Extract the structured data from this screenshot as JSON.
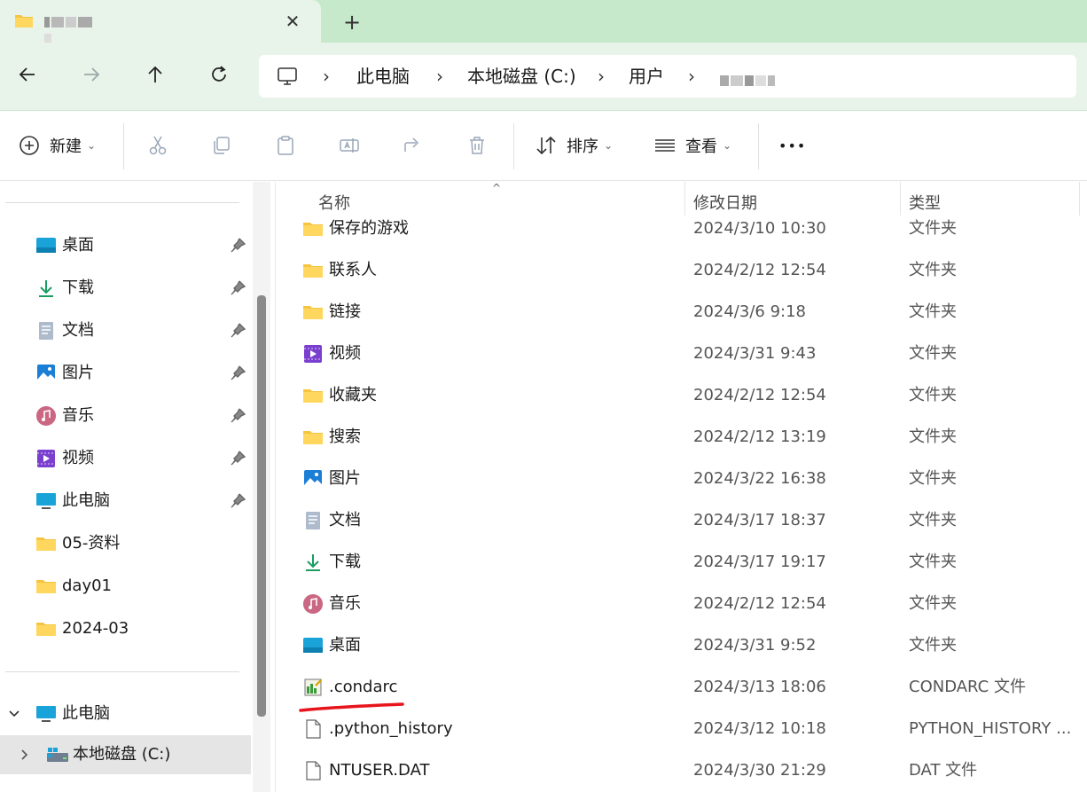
{
  "tab": {
    "close_glyph": "✕",
    "new_tab_glyph": "+"
  },
  "breadcrumb": {
    "items": [
      "此电脑",
      "本地磁盘 (C:)",
      "用户"
    ],
    "separator": "›"
  },
  "toolbar": {
    "new_label": "新建",
    "sort_label": "排序",
    "view_label": "查看",
    "more_label": "•••"
  },
  "sidebar": {
    "quick_access": [
      {
        "label": "桌面",
        "icon": "desktop-icon",
        "pinned": true
      },
      {
        "label": "下载",
        "icon": "download-icon",
        "pinned": true
      },
      {
        "label": "文档",
        "icon": "document-icon",
        "pinned": true
      },
      {
        "label": "图片",
        "icon": "pictures-icon",
        "pinned": true
      },
      {
        "label": "音乐",
        "icon": "music-icon",
        "pinned": true
      },
      {
        "label": "视频",
        "icon": "video-icon",
        "pinned": true
      },
      {
        "label": "此电脑",
        "icon": "computer-icon",
        "pinned": true
      },
      {
        "label": "05-资料",
        "icon": "folder-icon",
        "pinned": false
      },
      {
        "label": "day01",
        "icon": "folder-icon",
        "pinned": false
      },
      {
        "label": "2024-03",
        "icon": "folder-icon",
        "pinned": false
      }
    ],
    "this_pc_label": "此电脑",
    "local_disk_label": "本地磁盘 (C:)"
  },
  "columns": {
    "name": "名称",
    "modified": "修改日期",
    "type": "类型"
  },
  "files": [
    {
      "name": "保存的游戏",
      "modified": "2024/3/10 10:30",
      "type": "文件夹",
      "icon": "folder-icon"
    },
    {
      "name": "联系人",
      "modified": "2024/2/12 12:54",
      "type": "文件夹",
      "icon": "folder-icon"
    },
    {
      "name": "链接",
      "modified": "2024/3/6 9:18",
      "type": "文件夹",
      "icon": "folder-icon"
    },
    {
      "name": "视频",
      "modified": "2024/3/31 9:43",
      "type": "文件夹",
      "icon": "video-icon"
    },
    {
      "name": "收藏夹",
      "modified": "2024/2/12 12:54",
      "type": "文件夹",
      "icon": "folder-icon"
    },
    {
      "name": "搜索",
      "modified": "2024/2/12 13:19",
      "type": "文件夹",
      "icon": "folder-icon"
    },
    {
      "name": "图片",
      "modified": "2024/3/22 16:38",
      "type": "文件夹",
      "icon": "pictures-icon"
    },
    {
      "name": "文档",
      "modified": "2024/3/17 18:37",
      "type": "文件夹",
      "icon": "document-icon"
    },
    {
      "name": "下载",
      "modified": "2024/3/17 19:17",
      "type": "文件夹",
      "icon": "download-icon"
    },
    {
      "name": "音乐",
      "modified": "2024/2/12 12:54",
      "type": "文件夹",
      "icon": "music-icon"
    },
    {
      "name": "桌面",
      "modified": "2024/3/31 9:52",
      "type": "文件夹",
      "icon": "desktop-icon"
    },
    {
      "name": ".condarc",
      "modified": "2024/3/13 18:06",
      "type": "CONDARC 文件",
      "icon": "text-file-icon"
    },
    {
      "name": ".python_history",
      "modified": "2024/3/12 10:18",
      "type": "PYTHON_HISTORY ...",
      "icon": "blank-file-icon"
    },
    {
      "name": "NTUSER.DAT",
      "modified": "2024/3/30 21:29",
      "type": "DAT 文件",
      "icon": "blank-file-icon"
    }
  ],
  "colors": {
    "tabbar_bg": "#c6e9cb",
    "navbar_bg": "#e8f3ea",
    "folder_yellow": "#f5c542",
    "annotation_red": "#e8141c",
    "selection_gray": "#e5e5e5"
  }
}
